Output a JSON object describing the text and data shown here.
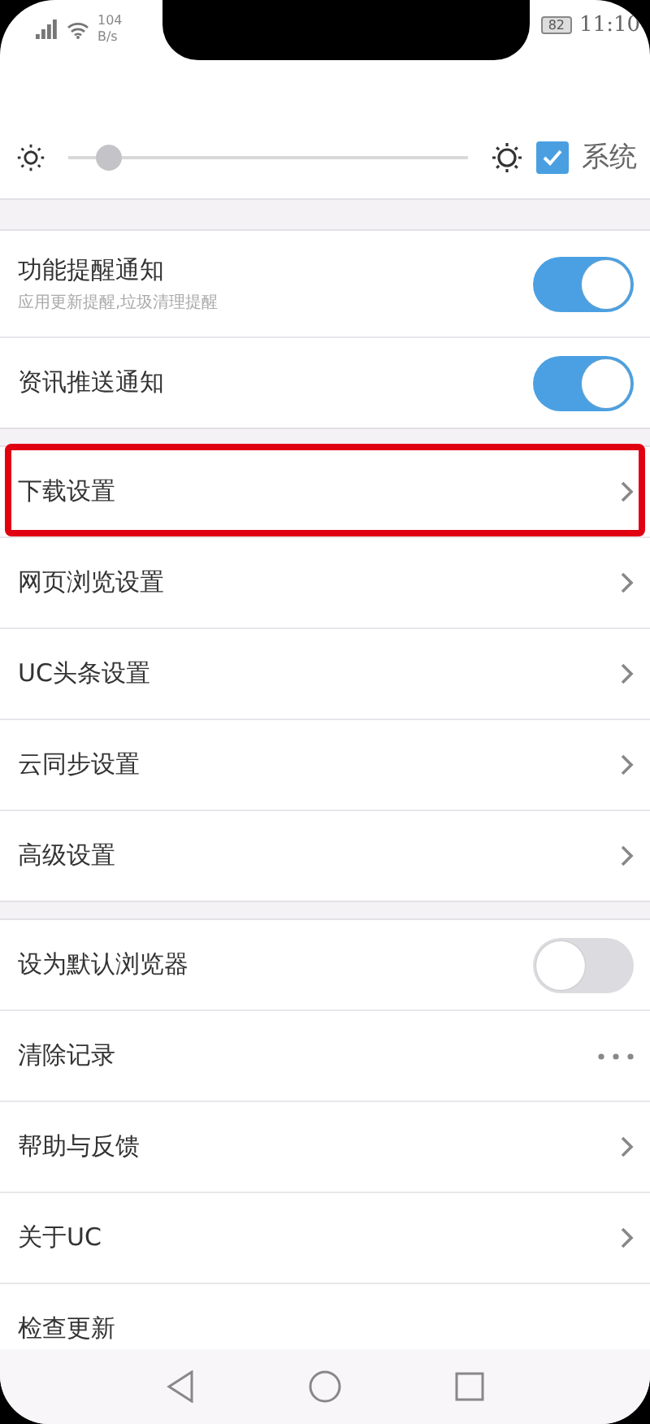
{
  "status_bar": {
    "network_speed": "104",
    "speed_unit": "B/s",
    "battery": "82",
    "time": "11:10"
  },
  "brightness": {
    "level": 0.1,
    "system": {
      "label": "系统",
      "checked": true
    }
  },
  "groups": [
    [
      {
        "kind": "toggle",
        "label": "功能提醒通知",
        "subtitle": "应用更新提醒,垃圾清理提醒",
        "on": true
      },
      {
        "kind": "toggle",
        "label": "资讯推送通知",
        "on": true
      }
    ],
    [
      {
        "kind": "link",
        "label": "下载设置",
        "highlighted": true
      },
      {
        "kind": "link",
        "label": "网页浏览设置",
        "highlighted": false
      },
      {
        "kind": "link",
        "label": "UC头条设置",
        "highlighted": false
      },
      {
        "kind": "link",
        "label": "云同步设置",
        "highlighted": false
      },
      {
        "kind": "link",
        "label": "高级设置",
        "highlighted": false
      }
    ],
    [
      {
        "kind": "toggle",
        "label": "设为默认浏览器",
        "on": false
      },
      {
        "kind": "more",
        "label": "清除记录"
      },
      {
        "kind": "link",
        "label": "帮助与反馈",
        "highlighted": false
      },
      {
        "kind": "link",
        "label": "关于UC",
        "highlighted": false
      },
      {
        "kind": "plain",
        "label": "检查更新"
      }
    ]
  ]
}
